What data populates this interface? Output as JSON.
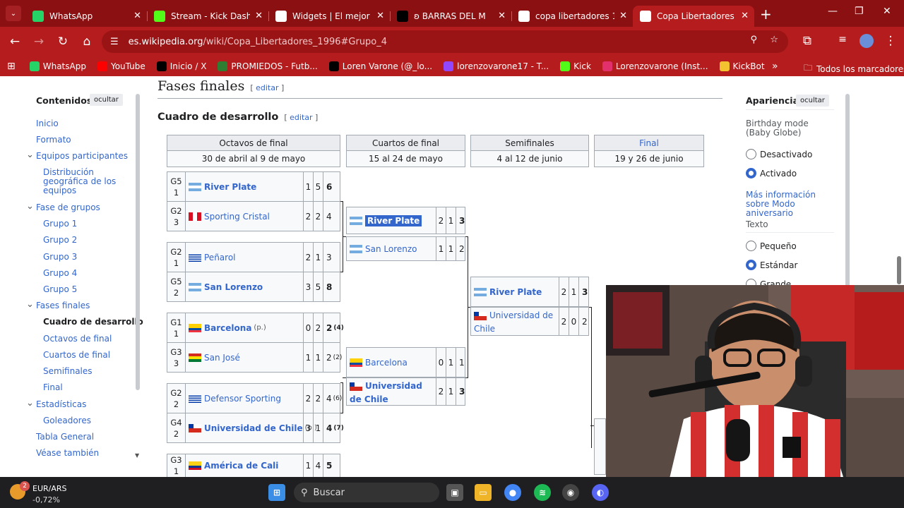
{
  "tabs": [
    {
      "title": "WhatsApp",
      "icon": "whatsapp-icon",
      "color": "#25d366"
    },
    {
      "title": "Stream - Kick Dashbo",
      "icon": "kick-icon",
      "color": "#53fc18"
    },
    {
      "title": "Widgets | El mejor so",
      "icon": "widgets-icon",
      "color": "#ffffff"
    },
    {
      "title": "ʚ BARRAS DEL M",
      "icon": "x-icon",
      "color": "#000000"
    },
    {
      "title": "copa libertadores 19",
      "icon": "google-icon",
      "color": "#ffffff"
    },
    {
      "title": "Copa Libertadores 19",
      "icon": "wikipedia-icon",
      "color": "#ffffff"
    }
  ],
  "url": {
    "host": "es.wikipedia.org",
    "path": "/wiki/Copa_Libertadores_1996#Grupo_4"
  },
  "bookmarks": [
    {
      "label": "WhatsApp",
      "icon": "whatsapp-icon",
      "color": "#25d366"
    },
    {
      "label": "YouTube",
      "icon": "youtube-icon",
      "color": "#ff0000"
    },
    {
      "label": "Inicio / X",
      "icon": "x-icon",
      "color": "#000000"
    },
    {
      "label": "PROMIEDOS - Futb...",
      "icon": "promiedos-icon",
      "color": "#2e7d32"
    },
    {
      "label": "Loren Varone (@_lo...",
      "icon": "tiktok-icon",
      "color": "#000000"
    },
    {
      "label": "lorenzovarone17 - T...",
      "icon": "twitch-icon",
      "color": "#9146ff"
    },
    {
      "label": "Kick",
      "icon": "kick-icon",
      "color": "#53fc18"
    },
    {
      "label": "Lorenzovarone (Inst...",
      "icon": "instagram-icon",
      "color": "#e1306c"
    },
    {
      "label": "KickBot",
      "icon": "kickbot-icon",
      "color": "#f4c430"
    }
  ],
  "bookmarks_all": "Todos los marcadores",
  "toc": {
    "title": "Contenidos",
    "hide": "ocultar",
    "items": [
      "Inicio",
      "Formato",
      "Equipos participantes",
      "Distribución geográfica de los equipos",
      "Fase de grupos",
      "Grupo 1",
      "Grupo 2",
      "Grupo 3",
      "Grupo 4",
      "Grupo 5",
      "Fases finales",
      "Cuadro de desarrollo",
      "Octavos de final",
      "Cuartos de final",
      "Semifinales",
      "Final",
      "Estadísticas",
      "Goleadores",
      "Tabla General",
      "Véase también"
    ]
  },
  "content": {
    "h2": "Fases finales",
    "h3": "Cuadro de desarrollo",
    "edit": "editar"
  },
  "rounds": [
    {
      "name": "Octavos de final",
      "dates": "30 de abril al 9 de mayo"
    },
    {
      "name": "Cuartos de final",
      "dates": "15 al 24 de mayo"
    },
    {
      "name": "Semifinales",
      "dates": "4 al 12 de junio"
    },
    {
      "name": "Final",
      "dates": "19 y 26 de junio"
    }
  ],
  "r16": [
    {
      "seed": "G5 1",
      "team": "River Plate",
      "flag": "ar",
      "win": true,
      "s1": "1",
      "s2": "5",
      "agg": "6",
      "note": ""
    },
    {
      "seed": "G2 3",
      "team": "Sporting Cristal",
      "flag": "pe",
      "win": false,
      "s1": "2",
      "s2": "2",
      "agg": "4",
      "note": ""
    },
    {
      "seed": "G2 1",
      "team": "Peñarol",
      "flag": "uy",
      "win": false,
      "s1": "2",
      "s2": "1",
      "agg": "3",
      "note": ""
    },
    {
      "seed": "G5 2",
      "team": "San Lorenzo",
      "flag": "ar",
      "win": true,
      "s1": "3",
      "s2": "5",
      "agg": "8",
      "note": ""
    },
    {
      "seed": "G1 1",
      "team": "Barcelona",
      "flag": "ec",
      "win": true,
      "s1": "0",
      "s2": "2",
      "agg": "2",
      "pen": "(4)",
      "note": "(p.)"
    },
    {
      "seed": "G3 3",
      "team": "San José",
      "flag": "bo",
      "win": false,
      "s1": "1",
      "s2": "1",
      "agg": "2",
      "pen": "(2)",
      "note": ""
    },
    {
      "seed": "G2 2",
      "team": "Defensor Sporting",
      "flag": "uy",
      "win": false,
      "s1": "2",
      "s2": "2",
      "agg": "4",
      "pen": "(6)",
      "note": ""
    },
    {
      "seed": "G4 2",
      "team": "Universidad de Chile",
      "flag": "cl",
      "win": true,
      "s1": "3",
      "s2": "1",
      "agg": "4",
      "pen": "(7)",
      "note": "(p.)"
    },
    {
      "seed": "G3 1",
      "team": "América de Cali",
      "flag": "co",
      "win": true,
      "s1": "1",
      "s2": "4",
      "agg": "5",
      "note": ""
    }
  ],
  "qf": [
    {
      "team": "River Plate",
      "flag": "ar",
      "win": true,
      "highlight": true,
      "s1": "2",
      "s2": "1",
      "agg": "3"
    },
    {
      "team": "San Lorenzo",
      "flag": "ar",
      "win": false,
      "s1": "1",
      "s2": "1",
      "agg": "2"
    },
    {
      "team": "Barcelona",
      "flag": "ec",
      "win": false,
      "s1": "0",
      "s2": "1",
      "agg": "1"
    },
    {
      "team": "Universidad de Chile",
      "flag": "cl",
      "win": true,
      "s1": "2",
      "s2": "1",
      "agg": "3"
    }
  ],
  "sf": [
    {
      "team": "River Plate",
      "flag": "ar",
      "win": true,
      "s1": "2",
      "s2": "1",
      "agg": "3"
    },
    {
      "team": "Universidad de Chile",
      "flag": "cl",
      "win": false,
      "s1": "2",
      "s2": "0",
      "agg": "2"
    }
  ],
  "appearance": {
    "title": "Apariencia",
    "hide": "ocultar",
    "birthday_label": "Birthday mode (Baby Globe)",
    "opt_off": "Desactivado",
    "opt_on": "Activado",
    "more_info": "Más información sobre Modo aniversario",
    "text_label": "Texto",
    "size_small": "Pequeño",
    "size_std": "Estándar",
    "size_big": "Grande"
  },
  "taskbar": {
    "currency": "EUR/ARS",
    "change": "-0,72%",
    "badge": "2",
    "search": "Buscar"
  }
}
